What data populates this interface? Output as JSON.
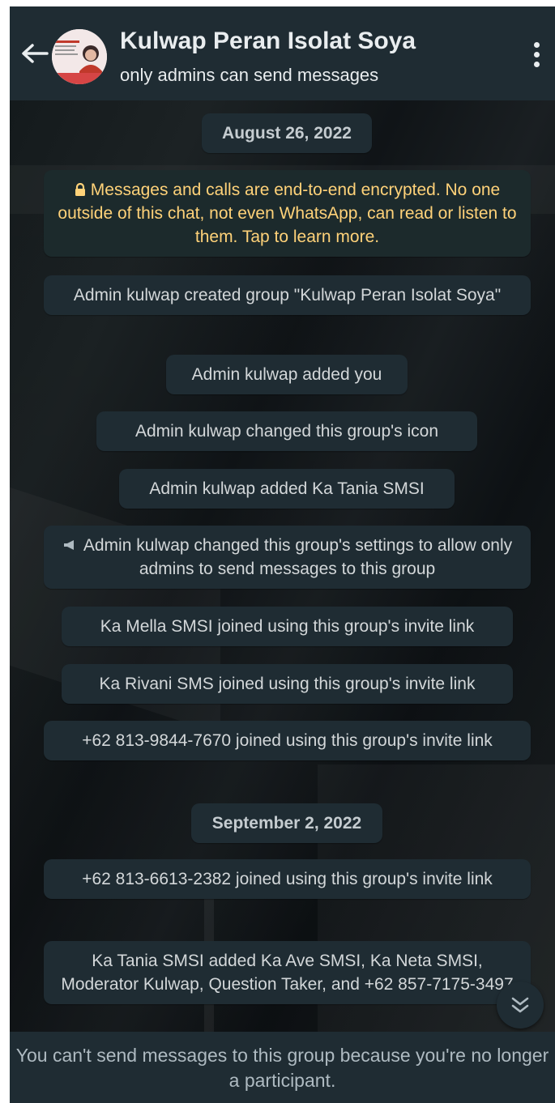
{
  "header": {
    "group_name": "Kulwap Peran Isolat Soya",
    "subtitle": "only admins can send messages"
  },
  "messages": [
    {
      "type": "date",
      "text": "August 26, 2022"
    },
    {
      "type": "encryption",
      "text": "Messages and calls are end-to-end encrypted. No one outside of this chat, not even WhatsApp, can read or listen to them. Tap to learn more."
    },
    {
      "type": "system",
      "text": "Admin kulwap created group \"Kulwap Peran Isolat Soya\""
    },
    {
      "type": "system",
      "text": "Admin kulwap added you"
    },
    {
      "type": "system",
      "text": "Admin kulwap changed this group's icon"
    },
    {
      "type": "system",
      "text": "Admin kulwap added Ka Tania SMSI"
    },
    {
      "type": "settings",
      "text": "Admin kulwap changed this group's settings to allow only admins to send messages to this group"
    },
    {
      "type": "system",
      "text": "Ka Mella SMSI joined using this group's invite link"
    },
    {
      "type": "system",
      "text": "Ka Rivani SMS joined using this group's invite link"
    },
    {
      "type": "system",
      "text": "+62 813-9844-7670 joined using this group's invite link"
    },
    {
      "type": "date",
      "text": "September 2, 2022"
    },
    {
      "type": "system",
      "text": "+62 813-6613-2382 joined using this group's invite link"
    },
    {
      "type": "system",
      "text": "Ka Tania SMSI added Ka Ave SMSI, Ka Neta SMSI, Moderator Kulwap, Question Taker, and +62 857-7175-3497"
    }
  ],
  "footer": {
    "notice": "You can't send messages to this group because you're no longer a participant."
  },
  "icons": {
    "back": "arrow-left-icon",
    "menu": "more-vertical-icon",
    "lock": "lock-icon",
    "settings": "megaphone-icon",
    "scroll": "double-chevron-down-icon"
  },
  "colors": {
    "header_bg": "#1f2c33",
    "bubble_bg": "#1f2c33",
    "encryption_text": "#ffd279",
    "text_primary": "#e9edef"
  }
}
